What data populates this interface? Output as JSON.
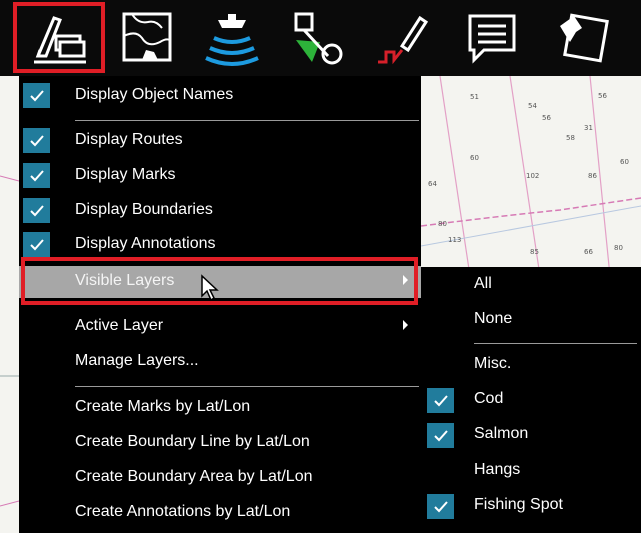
{
  "toolbar": {
    "buttons": [
      {
        "icon": "layers-icon",
        "highlighted": true
      },
      {
        "icon": "chart-icon"
      },
      {
        "icon": "sonar-boat-icon"
      },
      {
        "icon": "route-tools-icon"
      },
      {
        "icon": "track-icon"
      },
      {
        "icon": "flag-icon"
      },
      {
        "icon": "pushpin-icon"
      }
    ]
  },
  "chart": {
    "depths": [
      "51",
      "54",
      "56",
      "56",
      "31",
      "58",
      "60",
      "64",
      "102",
      "86",
      "60",
      "80",
      "113",
      "85",
      "66",
      "80"
    ]
  },
  "main_menu": {
    "items": [
      {
        "label": "Display Object Names",
        "checked": true
      },
      {
        "label": "Display Routes",
        "checked": true
      },
      {
        "label": "Display Marks",
        "checked": true
      },
      {
        "label": "Display Boundaries",
        "checked": true
      },
      {
        "label": "Display Annotations",
        "checked": true
      },
      {
        "label": "Visible Layers",
        "checked": false,
        "submenu": true,
        "selected": true
      },
      {
        "label": "Active Layer",
        "checked": false,
        "submenu": true
      },
      {
        "label": "Manage Layers...",
        "checked": false
      },
      {
        "label": "Create Marks by Lat/Lon",
        "checked": false
      },
      {
        "label": "Create Boundary Line by Lat/Lon",
        "checked": false
      },
      {
        "label": "Create Boundary Area by Lat/Lon",
        "checked": false
      },
      {
        "label": "Create Annotations by Lat/Lon",
        "checked": false
      }
    ]
  },
  "sub_menu": {
    "items": [
      {
        "label": "All",
        "checked": false
      },
      {
        "label": "None",
        "checked": false
      },
      {
        "label": "Misc.",
        "checked": false
      },
      {
        "label": "Cod",
        "checked": true
      },
      {
        "label": "Salmon",
        "checked": true
      },
      {
        "label": "Hangs",
        "checked": false
      },
      {
        "label": "Fishing Spot",
        "checked": true
      }
    ]
  },
  "colors": {
    "menu_bg": "#000000",
    "checkbox": "#217c9c",
    "highlight_outline": "#e01e26",
    "selected_row": "#a7a7a7"
  }
}
